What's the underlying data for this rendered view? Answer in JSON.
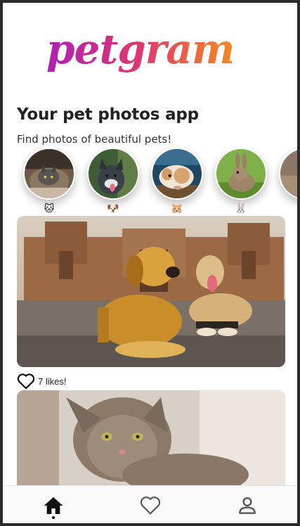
{
  "app": {
    "logo_text": "petgram",
    "logo_gradient": [
      "#b01fb5",
      "#e0376e",
      "#f48a1e"
    ]
  },
  "header": {
    "title": "Your pet photos app",
    "subtitle": "Find photos of beautiful pets!"
  },
  "categories": [
    {
      "name": "cats",
      "emoji": "🐱",
      "icon": "cat-face-icon"
    },
    {
      "name": "dogs",
      "emoji": "🐶",
      "icon": "dog-face-icon"
    },
    {
      "name": "hamsters",
      "emoji": "🐹",
      "icon": "hamster-face-icon"
    },
    {
      "name": "rabbits",
      "emoji": "🐰",
      "icon": "rabbit-face-icon"
    }
  ],
  "posts": [
    {
      "subject": "two dogs lying in front of cathedral",
      "likes_text": "7 likes!",
      "liked": false
    },
    {
      "subject": "tabby cat on couch"
    }
  ],
  "nav": {
    "items": [
      {
        "name": "home",
        "icon": "home-icon",
        "active": true
      },
      {
        "name": "favorites",
        "icon": "heart-outline-icon",
        "active": false
      },
      {
        "name": "profile",
        "icon": "person-icon",
        "active": false
      }
    ]
  }
}
